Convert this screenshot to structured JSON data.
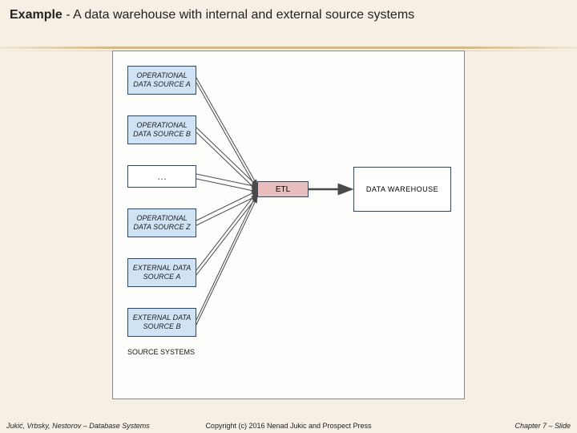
{
  "header": {
    "bold": "Example",
    "rest": " - A data warehouse with internal and external source systems"
  },
  "sources": {
    "a": "OPERATIONAL DATA SOURCE A",
    "b": "OPERATIONAL DATA SOURCE B",
    "ellipsis": "…",
    "z": "OPERATIONAL DATA SOURCE Z",
    "ext_a": "EXTERNAL DATA SOURCE A",
    "ext_b": "EXTERNAL DATA SOURCE B",
    "label": "SOURCE SYSTEMS"
  },
  "etl": {
    "label": "ETL"
  },
  "warehouse": {
    "label": "DATA  WAREHOUSE"
  },
  "footer": {
    "left": "Jukić, Vrbsky, Nestorov – Database Systems",
    "center": "Copyright (c) 2016 Nenad Jukic and Prospect Press",
    "right": "Chapter 7 – Slide"
  }
}
